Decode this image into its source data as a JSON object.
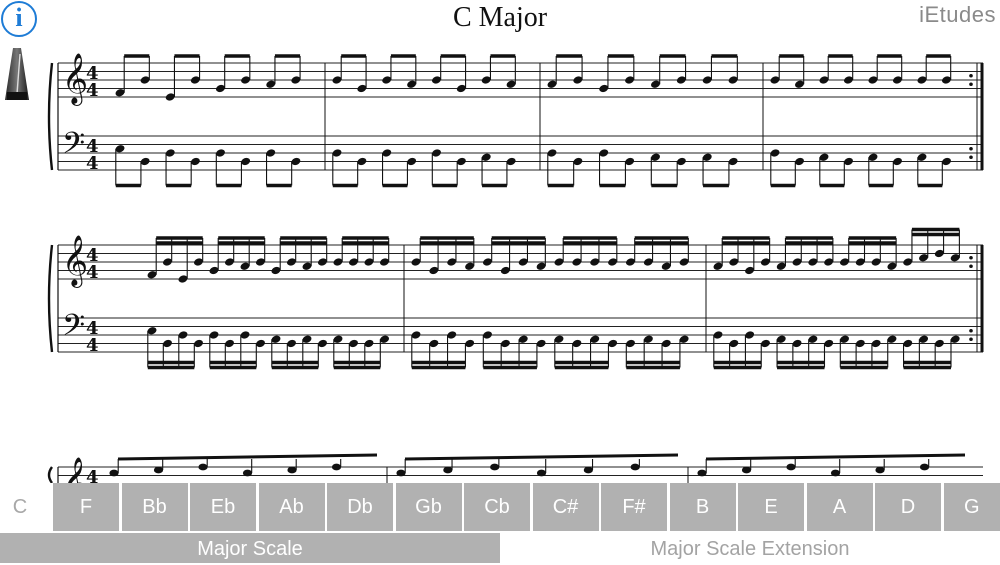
{
  "title": "C Major",
  "brand": "iEtudes",
  "info_button": {
    "glyph": "i",
    "icon": "info-icon",
    "color": "#1e7cd6"
  },
  "metronome": {
    "icon": "metronome-icon"
  },
  "score": {
    "time_signature": {
      "top": "4",
      "bottom": "4"
    },
    "clefs": [
      "treble",
      "bass"
    ]
  },
  "keys": {
    "selected": "C",
    "items": [
      "C",
      "F",
      "Bb",
      "Eb",
      "Ab",
      "Db",
      "Gb",
      "Cb",
      "C#",
      "F#",
      "B",
      "E",
      "A",
      "D",
      "G"
    ]
  },
  "modes": {
    "active": "Major Scale",
    "items": [
      "Major Scale",
      "Major Scale Extension"
    ]
  },
  "colors": {
    "accent": "#1e7cd6",
    "tab_gray": "#b1b1b1",
    "text_gray": "#a3a3a3"
  }
}
